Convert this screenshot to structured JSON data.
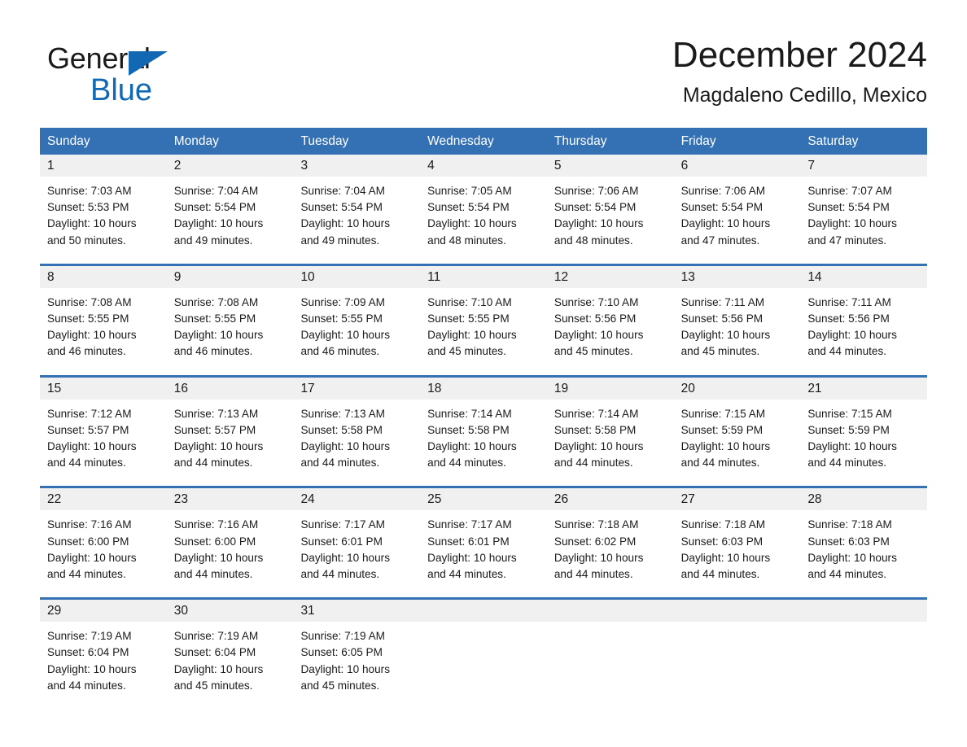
{
  "brand": {
    "name_part1": "General",
    "name_part2": "Blue",
    "triangle_color": "#1268b3",
    "text_color": "#1a1a1a"
  },
  "header": {
    "title": "December 2024",
    "subtitle": "Magdaleno Cedillo, Mexico"
  },
  "theme": {
    "header_blue": "#3371b4",
    "day_number_bg": "#f0f0f0",
    "page_bg": "#ffffff"
  },
  "weekdays": [
    "Sunday",
    "Monday",
    "Tuesday",
    "Wednesday",
    "Thursday",
    "Friday",
    "Saturday"
  ],
  "weeks": [
    [
      {
        "day": "1",
        "sunrise": "Sunrise: 7:03 AM",
        "sunset": "Sunset: 5:53 PM",
        "daylight_1": "Daylight: 10 hours",
        "daylight_2": "and 50 minutes."
      },
      {
        "day": "2",
        "sunrise": "Sunrise: 7:04 AM",
        "sunset": "Sunset: 5:54 PM",
        "daylight_1": "Daylight: 10 hours",
        "daylight_2": "and 49 minutes."
      },
      {
        "day": "3",
        "sunrise": "Sunrise: 7:04 AM",
        "sunset": "Sunset: 5:54 PM",
        "daylight_1": "Daylight: 10 hours",
        "daylight_2": "and 49 minutes."
      },
      {
        "day": "4",
        "sunrise": "Sunrise: 7:05 AM",
        "sunset": "Sunset: 5:54 PM",
        "daylight_1": "Daylight: 10 hours",
        "daylight_2": "and 48 minutes."
      },
      {
        "day": "5",
        "sunrise": "Sunrise: 7:06 AM",
        "sunset": "Sunset: 5:54 PM",
        "daylight_1": "Daylight: 10 hours",
        "daylight_2": "and 48 minutes."
      },
      {
        "day": "6",
        "sunrise": "Sunrise: 7:06 AM",
        "sunset": "Sunset: 5:54 PM",
        "daylight_1": "Daylight: 10 hours",
        "daylight_2": "and 47 minutes."
      },
      {
        "day": "7",
        "sunrise": "Sunrise: 7:07 AM",
        "sunset": "Sunset: 5:54 PM",
        "daylight_1": "Daylight: 10 hours",
        "daylight_2": "and 47 minutes."
      }
    ],
    [
      {
        "day": "8",
        "sunrise": "Sunrise: 7:08 AM",
        "sunset": "Sunset: 5:55 PM",
        "daylight_1": "Daylight: 10 hours",
        "daylight_2": "and 46 minutes."
      },
      {
        "day": "9",
        "sunrise": "Sunrise: 7:08 AM",
        "sunset": "Sunset: 5:55 PM",
        "daylight_1": "Daylight: 10 hours",
        "daylight_2": "and 46 minutes."
      },
      {
        "day": "10",
        "sunrise": "Sunrise: 7:09 AM",
        "sunset": "Sunset: 5:55 PM",
        "daylight_1": "Daylight: 10 hours",
        "daylight_2": "and 46 minutes."
      },
      {
        "day": "11",
        "sunrise": "Sunrise: 7:10 AM",
        "sunset": "Sunset: 5:55 PM",
        "daylight_1": "Daylight: 10 hours",
        "daylight_2": "and 45 minutes."
      },
      {
        "day": "12",
        "sunrise": "Sunrise: 7:10 AM",
        "sunset": "Sunset: 5:56 PM",
        "daylight_1": "Daylight: 10 hours",
        "daylight_2": "and 45 minutes."
      },
      {
        "day": "13",
        "sunrise": "Sunrise: 7:11 AM",
        "sunset": "Sunset: 5:56 PM",
        "daylight_1": "Daylight: 10 hours",
        "daylight_2": "and 45 minutes."
      },
      {
        "day": "14",
        "sunrise": "Sunrise: 7:11 AM",
        "sunset": "Sunset: 5:56 PM",
        "daylight_1": "Daylight: 10 hours",
        "daylight_2": "and 44 minutes."
      }
    ],
    [
      {
        "day": "15",
        "sunrise": "Sunrise: 7:12 AM",
        "sunset": "Sunset: 5:57 PM",
        "daylight_1": "Daylight: 10 hours",
        "daylight_2": "and 44 minutes."
      },
      {
        "day": "16",
        "sunrise": "Sunrise: 7:13 AM",
        "sunset": "Sunset: 5:57 PM",
        "daylight_1": "Daylight: 10 hours",
        "daylight_2": "and 44 minutes."
      },
      {
        "day": "17",
        "sunrise": "Sunrise: 7:13 AM",
        "sunset": "Sunset: 5:58 PM",
        "daylight_1": "Daylight: 10 hours",
        "daylight_2": "and 44 minutes."
      },
      {
        "day": "18",
        "sunrise": "Sunrise: 7:14 AM",
        "sunset": "Sunset: 5:58 PM",
        "daylight_1": "Daylight: 10 hours",
        "daylight_2": "and 44 minutes."
      },
      {
        "day": "19",
        "sunrise": "Sunrise: 7:14 AM",
        "sunset": "Sunset: 5:58 PM",
        "daylight_1": "Daylight: 10 hours",
        "daylight_2": "and 44 minutes."
      },
      {
        "day": "20",
        "sunrise": "Sunrise: 7:15 AM",
        "sunset": "Sunset: 5:59 PM",
        "daylight_1": "Daylight: 10 hours",
        "daylight_2": "and 44 minutes."
      },
      {
        "day": "21",
        "sunrise": "Sunrise: 7:15 AM",
        "sunset": "Sunset: 5:59 PM",
        "daylight_1": "Daylight: 10 hours",
        "daylight_2": "and 44 minutes."
      }
    ],
    [
      {
        "day": "22",
        "sunrise": "Sunrise: 7:16 AM",
        "sunset": "Sunset: 6:00 PM",
        "daylight_1": "Daylight: 10 hours",
        "daylight_2": "and 44 minutes."
      },
      {
        "day": "23",
        "sunrise": "Sunrise: 7:16 AM",
        "sunset": "Sunset: 6:00 PM",
        "daylight_1": "Daylight: 10 hours",
        "daylight_2": "and 44 minutes."
      },
      {
        "day": "24",
        "sunrise": "Sunrise: 7:17 AM",
        "sunset": "Sunset: 6:01 PM",
        "daylight_1": "Daylight: 10 hours",
        "daylight_2": "and 44 minutes."
      },
      {
        "day": "25",
        "sunrise": "Sunrise: 7:17 AM",
        "sunset": "Sunset: 6:01 PM",
        "daylight_1": "Daylight: 10 hours",
        "daylight_2": "and 44 minutes."
      },
      {
        "day": "26",
        "sunrise": "Sunrise: 7:18 AM",
        "sunset": "Sunset: 6:02 PM",
        "daylight_1": "Daylight: 10 hours",
        "daylight_2": "and 44 minutes."
      },
      {
        "day": "27",
        "sunrise": "Sunrise: 7:18 AM",
        "sunset": "Sunset: 6:03 PM",
        "daylight_1": "Daylight: 10 hours",
        "daylight_2": "and 44 minutes."
      },
      {
        "day": "28",
        "sunrise": "Sunrise: 7:18 AM",
        "sunset": "Sunset: 6:03 PM",
        "daylight_1": "Daylight: 10 hours",
        "daylight_2": "and 44 minutes."
      }
    ],
    [
      {
        "day": "29",
        "sunrise": "Sunrise: 7:19 AM",
        "sunset": "Sunset: 6:04 PM",
        "daylight_1": "Daylight: 10 hours",
        "daylight_2": "and 44 minutes."
      },
      {
        "day": "30",
        "sunrise": "Sunrise: 7:19 AM",
        "sunset": "Sunset: 6:04 PM",
        "daylight_1": "Daylight: 10 hours",
        "daylight_2": "and 45 minutes."
      },
      {
        "day": "31",
        "sunrise": "Sunrise: 7:19 AM",
        "sunset": "Sunset: 6:05 PM",
        "daylight_1": "Daylight: 10 hours",
        "daylight_2": "and 45 minutes."
      },
      {
        "day": "",
        "sunrise": "",
        "sunset": "",
        "daylight_1": "",
        "daylight_2": ""
      },
      {
        "day": "",
        "sunrise": "",
        "sunset": "",
        "daylight_1": "",
        "daylight_2": ""
      },
      {
        "day": "",
        "sunrise": "",
        "sunset": "",
        "daylight_1": "",
        "daylight_2": ""
      },
      {
        "day": "",
        "sunrise": "",
        "sunset": "",
        "daylight_1": "",
        "daylight_2": ""
      }
    ]
  ]
}
